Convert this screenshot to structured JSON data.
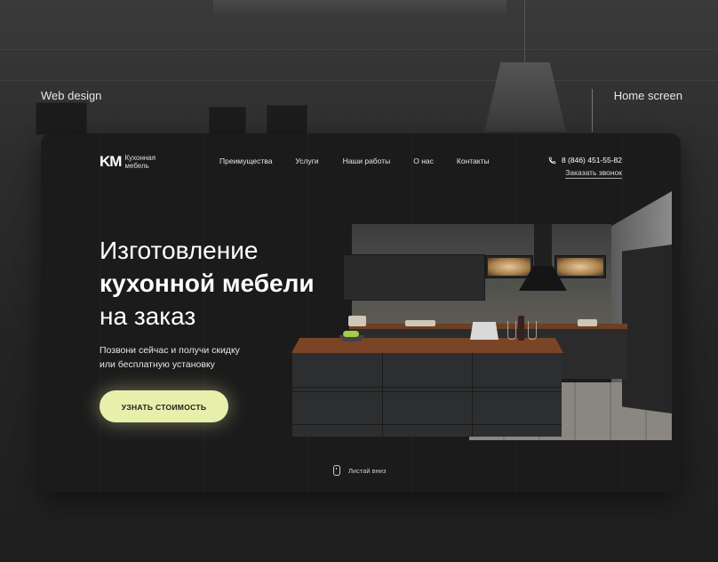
{
  "frame": {
    "left_label": "Web design",
    "right_label": "Home screen"
  },
  "header": {
    "logo_mark": "KM",
    "logo_line1": "Кухонная",
    "logo_line2": "мебель",
    "nav": [
      {
        "label": "Преимущества"
      },
      {
        "label": "Услуги"
      },
      {
        "label": "Наши работы"
      },
      {
        "label": "О нас"
      },
      {
        "label": "Контакты"
      }
    ],
    "phone": "8 (846) 451-55-82",
    "callback": "Заказать звонок"
  },
  "hero": {
    "title_line1": "Изготовление",
    "title_line2": "кухонной мебели",
    "title_line3": "на заказ",
    "subtitle_line1": "Позвони сейчас и получи скидку",
    "subtitle_line2": "или бесплатную установку",
    "cta": "УЗНАТЬ СТОИМОСТЬ"
  },
  "scroll_hint": "Листай вниз",
  "colors": {
    "accent": "#e7efaa",
    "card_bg": "#1b1b1b",
    "page_bg": "#2a2a2a"
  },
  "icons": {
    "phone": "phone-icon",
    "mouse": "mouse-scroll-icon"
  }
}
